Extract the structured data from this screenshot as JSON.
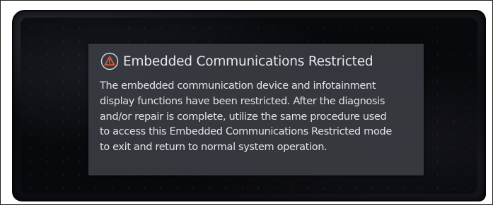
{
  "dialog": {
    "icon": "warning-icon",
    "title": "Embedded Communications Restricted",
    "lines": [
      "The embedded communication device and infotainment",
      "display functions have been restricted. After the diagnosis",
      "and/or repair is complete, utilize the same procedure used",
      "to access this Embedded Communications Restricted mode",
      "to exit and return to normal system operation."
    ]
  },
  "colors": {
    "warning": "#e8542a",
    "screen": "#08090c",
    "dialog": "#3a3c42"
  }
}
